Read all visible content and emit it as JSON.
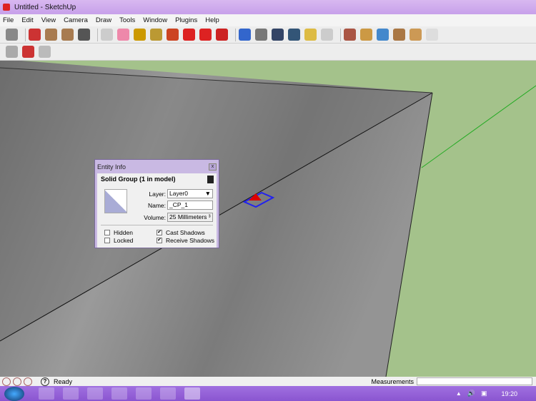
{
  "window": {
    "title": "Untitled - SketchUp"
  },
  "menu": [
    "File",
    "Edit",
    "View",
    "Camera",
    "Draw",
    "Tools",
    "Window",
    "Plugins",
    "Help"
  ],
  "toolbar1": [
    "select",
    "pencil",
    "rectangle",
    "circle",
    "arc",
    "make-component",
    "eraser",
    "tape-measure",
    "paint-bucket",
    "push-pull",
    "move",
    "rotate",
    "follow-me",
    "orbit",
    "pan",
    "zoom",
    "zoom-extents",
    "previous-view",
    "next-view",
    "3d-warehouse",
    "share-model",
    "google-earth",
    "get-models",
    "component",
    "layer"
  ],
  "toolbar2": [
    "sandbox-smoove",
    "dynamic-component",
    "solid-tools"
  ],
  "entity_info": {
    "title": "Entity Info",
    "close": "x",
    "heading": "Solid Group (1 in model)",
    "layer_label": "Layer:",
    "layer_value": "Layer0",
    "name_label": "Name:",
    "name_value": "_CP_1",
    "volume_label": "Volume:",
    "volume_value": "25 Millimeters ³",
    "hidden": "Hidden",
    "locked": "Locked",
    "cast_shadows": "Cast Shadows",
    "receive_shadows": "Receive Shadows",
    "hidden_checked": false,
    "locked_checked": false,
    "cast_checked": true,
    "receive_checked": true
  },
  "status": {
    "text": "Ready",
    "measurements_label": "Measurements",
    "measurements_value": ""
  },
  "taskbar": {
    "clock": "19:20"
  },
  "colors": {
    "ground": "#a4c28b",
    "box": "#8a8a8a",
    "title": "#c7a0ea"
  }
}
